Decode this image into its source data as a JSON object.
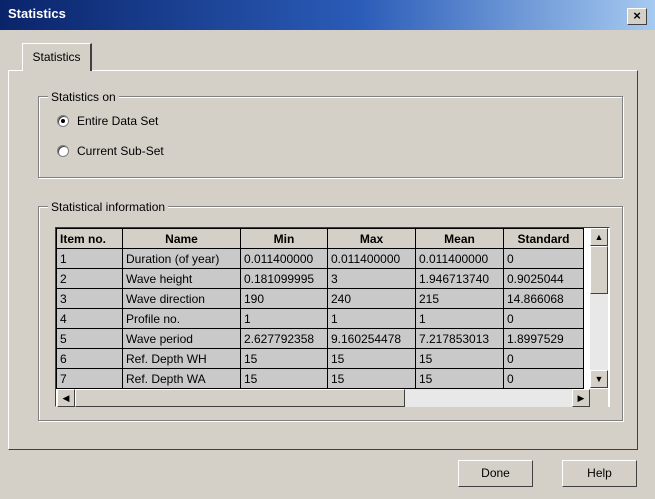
{
  "window": {
    "title": "Statistics",
    "close_glyph": "×"
  },
  "tab": {
    "label": "Statistics"
  },
  "statistics_on": {
    "label": "Statistics on",
    "options": [
      {
        "label": "Entire Data Set",
        "selected": true
      },
      {
        "label": "Current Sub-Set",
        "selected": false
      }
    ]
  },
  "statistical_information": {
    "label": "Statistical information",
    "columns": [
      "Item no.",
      "Name",
      "Min",
      "Max",
      "Mean",
      "Standard"
    ],
    "rows": [
      [
        "1",
        "Duration (of year)",
        "0.011400000",
        "0.011400000",
        "0.011400000",
        "0"
      ],
      [
        "2",
        "Wave height",
        "0.181099995",
        "3",
        "1.946713740",
        "0.9025044"
      ],
      [
        "3",
        "Wave direction",
        "190",
        "240",
        "215",
        "14.866068"
      ],
      [
        "4",
        "Profile no.",
        "1",
        "1",
        "1",
        "0"
      ],
      [
        "5",
        "Wave period",
        "2.627792358",
        "9.160254478",
        "7.217853013",
        "1.8997529"
      ],
      [
        "6",
        "Ref. Depth WH",
        "15",
        "15",
        "15",
        "0"
      ],
      [
        "7",
        "Ref. Depth WA",
        "15",
        "15",
        "15",
        "0"
      ]
    ]
  },
  "buttons": {
    "done": "Done",
    "help": "Help"
  },
  "icons": {
    "scroll_up": "up-arrow-icon",
    "scroll_down": "down-arrow-icon",
    "scroll_left": "left-arrow-icon",
    "scroll_right": "right-arrow-icon"
  }
}
